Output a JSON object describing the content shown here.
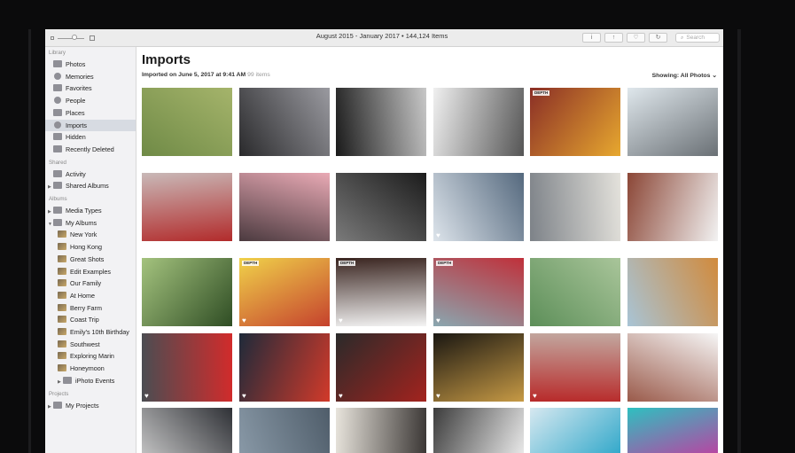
{
  "window": {
    "title": "August 2015 - January 2017 • 144,124 Items",
    "toolbar": {
      "info_glyph": "i",
      "share_glyph": "↑",
      "heart_glyph": "♡",
      "rotate_glyph": "↻",
      "search_glyph": "⌕"
    },
    "search_placeholder": "Search"
  },
  "sidebar": {
    "sections": [
      {
        "title": "Library",
        "items": [
          {
            "label": "Photos",
            "icon": "photos-icon"
          },
          {
            "label": "Memories",
            "icon": "memories-icon"
          },
          {
            "label": "Favorites",
            "icon": "heart-icon"
          },
          {
            "label": "People",
            "icon": "person-icon"
          },
          {
            "label": "Places",
            "icon": "pin-icon"
          },
          {
            "label": "Imports",
            "icon": "clock-icon",
            "selected": true
          },
          {
            "label": "Hidden",
            "icon": "hidden-icon"
          },
          {
            "label": "Recently Deleted",
            "icon": "trash-icon"
          }
        ]
      },
      {
        "title": "Shared",
        "items": [
          {
            "label": "Activity",
            "icon": "cloud-icon"
          },
          {
            "label": "Shared Albums",
            "icon": "folder-icon",
            "disclosure": true
          }
        ]
      },
      {
        "title": "Albums",
        "items": [
          {
            "label": "Media Types",
            "icon": "folder-icon",
            "disclosure": true
          },
          {
            "label": "My Albums",
            "icon": "folder-icon",
            "disclosure": true,
            "expanded": true
          },
          {
            "label": "New York",
            "icon": "album-thumb-icon",
            "indent": true
          },
          {
            "label": "Hong Kong",
            "icon": "album-thumb-icon",
            "indent": true
          },
          {
            "label": "Great Shots",
            "icon": "album-thumb-icon",
            "indent": true
          },
          {
            "label": "Edit Examples",
            "icon": "album-thumb-icon",
            "indent": true
          },
          {
            "label": "Our Family",
            "icon": "album-thumb-icon",
            "indent": true
          },
          {
            "label": "At Home",
            "icon": "album-thumb-icon",
            "indent": true
          },
          {
            "label": "Berry Farm",
            "icon": "album-thumb-icon",
            "indent": true
          },
          {
            "label": "Coast Trip",
            "icon": "album-thumb-icon",
            "indent": true
          },
          {
            "label": "Emily's 10th Birthday",
            "icon": "album-thumb-icon",
            "indent": true
          },
          {
            "label": "Southwest",
            "icon": "album-thumb-icon",
            "indent": true
          },
          {
            "label": "Exploring Marin",
            "icon": "album-thumb-icon",
            "indent": true
          },
          {
            "label": "Honeymoon",
            "icon": "album-thumb-icon",
            "indent": true
          },
          {
            "label": "iPhoto Events",
            "icon": "folder-icon",
            "disclosure": true,
            "indent": true
          }
        ]
      },
      {
        "title": "Projects",
        "items": [
          {
            "label": "My Projects",
            "icon": "folder-icon",
            "disclosure": true
          }
        ]
      }
    ]
  },
  "main": {
    "title": "Imports",
    "subtitle": "Imported on June 5, 2017 at 9:41 AM",
    "count": "99 items",
    "showing": "Showing: All Photos ⌄",
    "depth_label": "DEPTH",
    "heart_glyph": "♥",
    "photos": [
      {
        "name": "photo-grass-feet",
        "colors": [
          "#6f8a46",
          "#a5b46b"
        ]
      },
      {
        "name": "photo-metal-curves",
        "colors": [
          "#2a2a2c",
          "#9a9aa0"
        ]
      },
      {
        "name": "photo-building-bw",
        "colors": [
          "#1a1a1a",
          "#c8c8c8"
        ]
      },
      {
        "name": "photo-marble",
        "colors": [
          "#f0f0f0",
          "#555555"
        ]
      },
      {
        "name": "photo-yellow-beanie",
        "colors": [
          "#8a2e26",
          "#e7a82f"
        ],
        "depth": true
      },
      {
        "name": "photo-towers-up",
        "colors": [
          "#dfe7ec",
          "#6a7075"
        ]
      },
      {
        "name": "photo-red-shirt",
        "colors": [
          "#c9b9b8",
          "#b22b2b"
        ]
      },
      {
        "name": "photo-pink-city",
        "colors": [
          "#e9aab5",
          "#4b3a3f"
        ]
      },
      {
        "name": "photo-stairs-dark",
        "colors": [
          "#1c1c1c",
          "#7a7a7a"
        ]
      },
      {
        "name": "photo-skyscraper",
        "colors": [
          "#55697e",
          "#dde4eb"
        ],
        "favorite": true
      },
      {
        "name": "photo-apartments",
        "colors": [
          "#e4e2dc",
          "#7d8288"
        ]
      },
      {
        "name": "photo-brick-tower",
        "colors": [
          "#f2f2f2",
          "#8b4636"
        ]
      },
      {
        "name": "photo-palm",
        "colors": [
          "#2f4d24",
          "#a4c37e"
        ]
      },
      {
        "name": "photo-curly-woman",
        "colors": [
          "#c5412d",
          "#f0d24a"
        ],
        "depth": true,
        "favorite": true
      },
      {
        "name": "photo-profile-man",
        "colors": [
          "#f4f4f4",
          "#3a2520"
        ],
        "depth": true,
        "favorite": true
      },
      {
        "name": "photo-red-beanie",
        "colors": [
          "#8aa7b0",
          "#c0303a"
        ],
        "depth": true,
        "favorite": true
      },
      {
        "name": "photo-aerial-field",
        "colors": [
          "#5d8f59",
          "#a9c59a"
        ]
      },
      {
        "name": "photo-sunset-woman",
        "colors": [
          "#a8c4d6",
          "#d18a3c"
        ]
      },
      {
        "name": "photo-red-car",
        "colors": [
          "#4a4d52",
          "#d22b2b"
        ],
        "favorite": true
      },
      {
        "name": "photo-bokeh",
        "colors": [
          "#1e2a3a",
          "#d23a2a"
        ],
        "favorite": true
      },
      {
        "name": "photo-red-sculpture",
        "colors": [
          "#2a2a2a",
          "#a3231e"
        ],
        "favorite": true
      },
      {
        "name": "photo-lights-night",
        "colors": [
          "#1a1712",
          "#c79a45"
        ],
        "favorite": true
      },
      {
        "name": "photo-bridge-red-hat",
        "colors": [
          "#c2a8a0",
          "#b82a2a"
        ],
        "favorite": true
      },
      {
        "name": "photo-white-building",
        "colors": [
          "#f6f6f6",
          "#9a5a4a"
        ]
      },
      {
        "name": "photo-streetlamp",
        "colors": [
          "#2f3136",
          "#c8c8c8"
        ]
      },
      {
        "name": "photo-steps-runner",
        "colors": [
          "#4f5d6a",
          "#8a9aa8"
        ]
      },
      {
        "name": "photo-atrium",
        "colors": [
          "#3a3634",
          "#e8e4dc"
        ]
      },
      {
        "name": "photo-stripes",
        "colors": [
          "#eeeeee",
          "#3c3c3c"
        ]
      },
      {
        "name": "photo-jumper",
        "colors": [
          "#2aa5c8",
          "#d6e8f0"
        ]
      },
      {
        "name": "photo-colorful-woman",
        "colors": [
          "#c43aa0",
          "#2ec0c0"
        ]
      }
    ]
  }
}
